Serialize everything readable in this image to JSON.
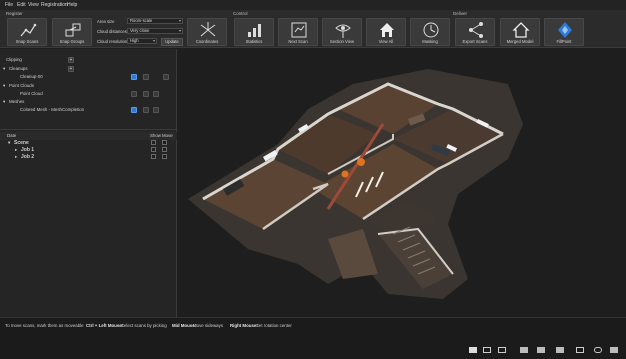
{
  "menu": [
    "File",
    "Edit",
    "View",
    "Registration",
    "Help"
  ],
  "toolbar": {
    "groups": {
      "register": "Register",
      "control": "Control",
      "deliver": "Deliver"
    },
    "snap_scans": "Snap Scans",
    "snap_groups": "Snap Groups",
    "area_size_label": "Area size",
    "area_size_value": "Room-scale",
    "cloud_distances_label": "Cloud distances",
    "cloud_distances_value": "Very close",
    "cloud_resolution_label": "Cloud resolution",
    "cloud_resolution_value": "High",
    "update": "Update",
    "coordinates": "Coordinates",
    "statistics": "Statistics",
    "next_scan": "Next Scan",
    "section_view": "Section View",
    "view_all": "View All",
    "masking": "Masking",
    "export_scans": "Export Scans",
    "merged_model": "Merged Model",
    "fill_point": "FillPoint"
  },
  "panel": {
    "clipping": "Clipping",
    "cleanups": "Cleanups",
    "cleanup_item": "Cleanup-00",
    "point_clouds": "Point Clouds",
    "point_cloud_item": "Point Cloud",
    "meshes": "Meshes",
    "mesh_item": "Colored Mesh - MeshCompletion",
    "table_headers": {
      "date": "Date",
      "show": "Show",
      "move": "Move"
    },
    "scene": "Scene",
    "jobs": [
      "Job 1",
      "Job 2"
    ]
  },
  "status": {
    "hint": "To move scans, mark them as moveable",
    "ctrl_left_key": "Ctrl + Left Mouse:",
    "ctrl_left_text": "Select scans by picking",
    "mid_key": "Mid Mouse:",
    "mid_text": "Move sideways",
    "right_key": "Right Mouse:",
    "right_text": "Set rotation center"
  },
  "colors": {
    "accent": "#2d7bd6",
    "background": "#1e1e1e",
    "toolbar": "#2b2b2b"
  }
}
